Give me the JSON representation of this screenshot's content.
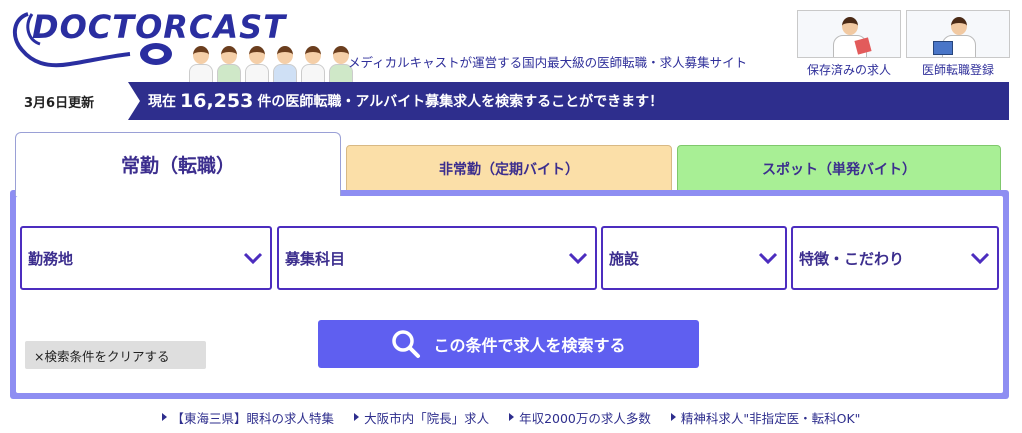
{
  "brand": {
    "logo_text": "DOCTORCAST",
    "tagline": "メディカルキャストが運営する国内最大級の医師転職・求人募集サイト"
  },
  "header_links": [
    {
      "label": "保存済みの求人",
      "icon": "nurse-icon"
    },
    {
      "label": "医師転職登録",
      "icon": "doctor-tablet-icon"
    }
  ],
  "notice": {
    "date_label": "3月6日更新",
    "prefix": "現在",
    "count": "16,253",
    "suffix": "件の医師転職・アルバイト募集求人を検索することができます！"
  },
  "tabs": [
    {
      "label": "常勤（転職）",
      "active": true
    },
    {
      "label": "非常勤（定期バイト）",
      "active": false
    },
    {
      "label": "スポット（単発バイト）",
      "active": false
    }
  ],
  "filters": [
    {
      "label": "勤務地"
    },
    {
      "label": "募集科目"
    },
    {
      "label": "施設"
    },
    {
      "label": "特徴・こだわり"
    }
  ],
  "clear_label": "×検索条件をクリアする",
  "search_label": "この条件で求人を検索する",
  "links": [
    "【東海三県】眼科の求人特集",
    "大阪市内「院長」求人",
    "年収2000万の求人多数",
    "精神科求人\"非指定医・転科OK\""
  ],
  "colors": {
    "navy": "#2e2e8d",
    "accent": "#5f5ff0",
    "panel": "#8e8ef2",
    "part_tab": "#fbdfa8",
    "spot_tab": "#a8ef95"
  }
}
